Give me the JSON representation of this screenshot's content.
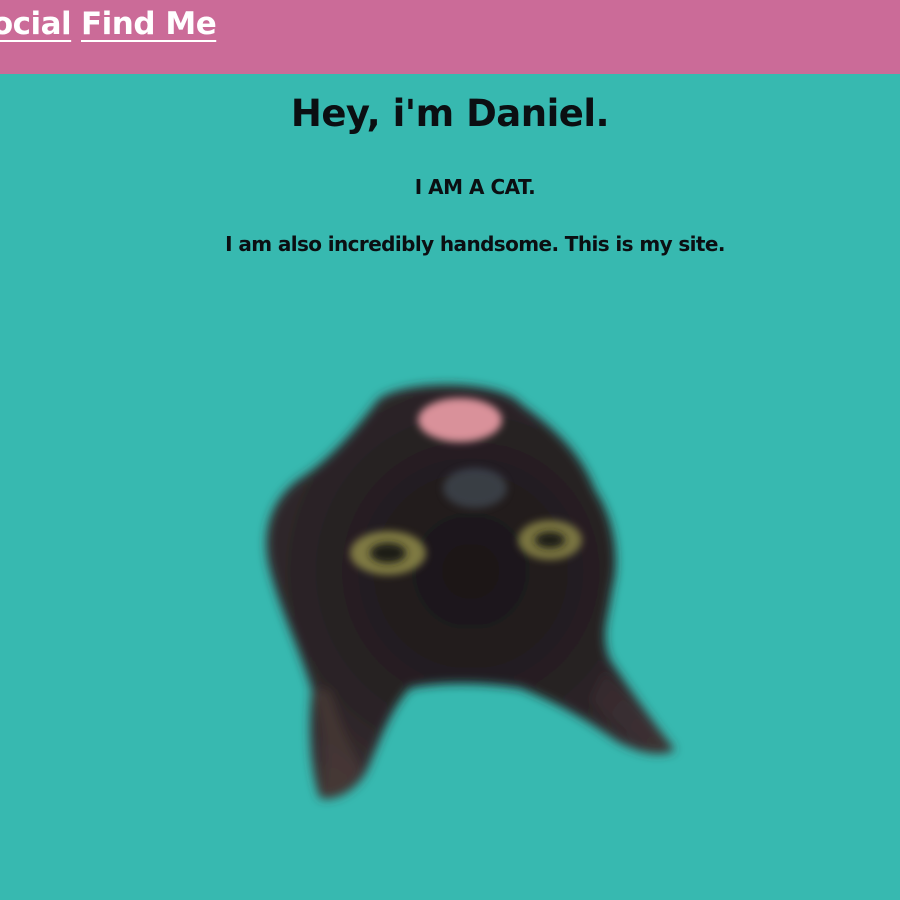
{
  "nav": {
    "social_label": "Social",
    "find_me_label": "Find Me"
  },
  "main": {
    "headline": "Hey, i'm Daniel.",
    "subhead": "I AM A CAT.",
    "tagline": "I am also incredibly handsome. This is my site."
  },
  "image": {
    "subject": "cat-photo"
  },
  "colors": {
    "nav_background": "#cb6b98",
    "page_background": "#37b9b0",
    "nav_text": "#ffffff",
    "body_text": "#0b0f12"
  }
}
